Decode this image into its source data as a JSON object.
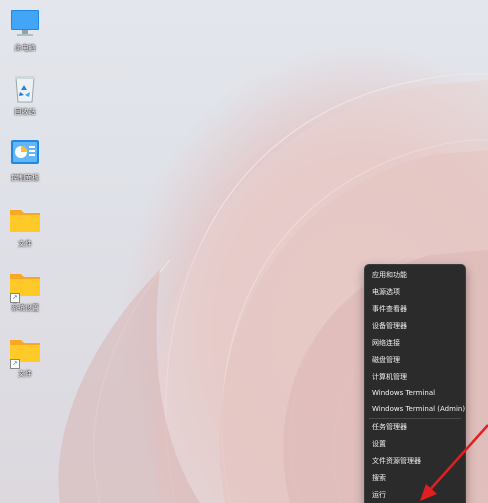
{
  "desktop": {
    "icons": [
      {
        "name": "this-pc",
        "label": "此电脑",
        "icon": "monitor-icon"
      },
      {
        "name": "recycle-bin",
        "label": "回收站",
        "icon": "recycle-bin-icon"
      },
      {
        "name": "control-panel",
        "label": "控制面板",
        "icon": "control-panel-icon"
      },
      {
        "name": "folder-1",
        "label": "文件",
        "icon": "folder-icon"
      },
      {
        "name": "folder-2",
        "label": "系统设置",
        "icon": "folder-shortcut-icon"
      },
      {
        "name": "folder-3",
        "label": "文件",
        "icon": "folder-shortcut-icon"
      }
    ]
  },
  "context_menu": {
    "items": [
      "应用和功能",
      "电源选项",
      "事件查看器",
      "设备管理器",
      "网络连接",
      "磁盘管理",
      "计算机管理",
      "Windows Terminal",
      "Windows Terminal (Admin)",
      "任务管理器",
      "设置",
      "文件资源管理器",
      "搜索",
      "运行"
    ]
  },
  "colors": {
    "menu_bg": "#2b2b2b",
    "annotation_arrow": "#e02020"
  }
}
